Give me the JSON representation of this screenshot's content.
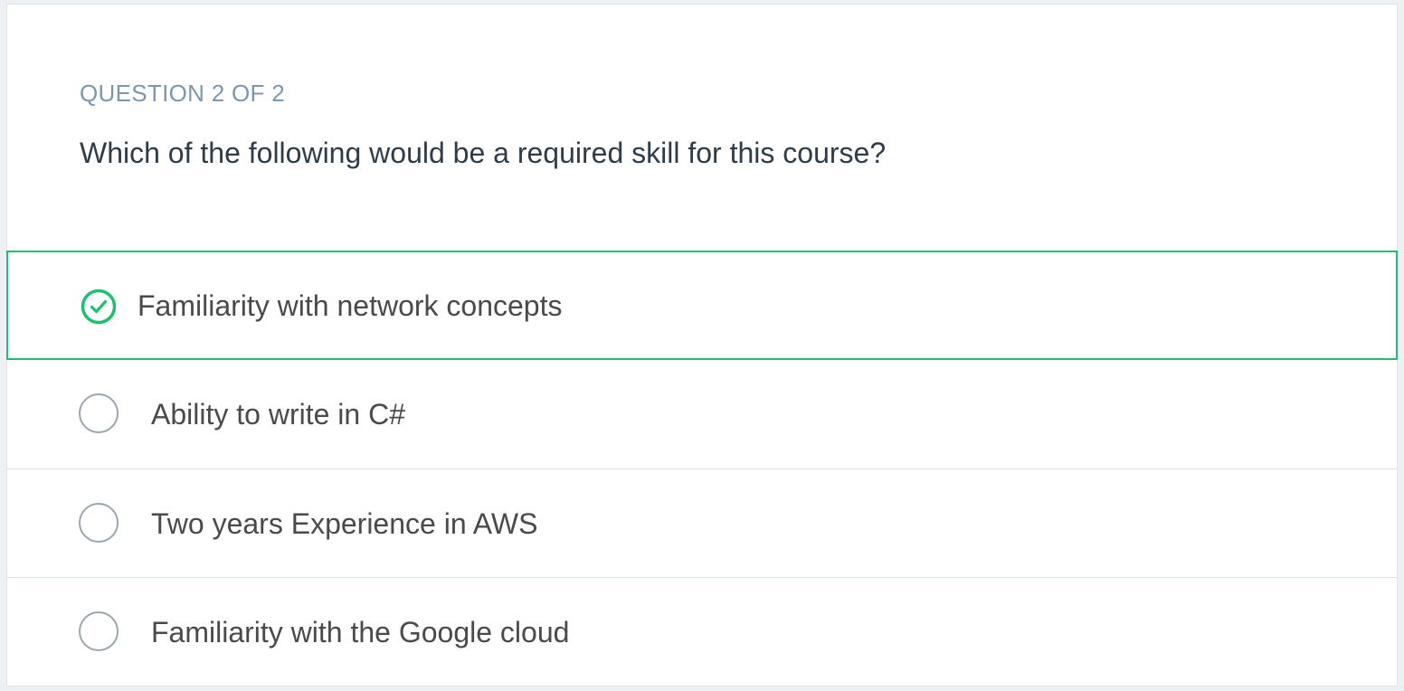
{
  "quiz": {
    "counter": "QUESTION 2 OF 2",
    "question": "Which of the following would be a required skill for this course?",
    "accent_color": "#1fbf71",
    "options": [
      {
        "label": "Familiarity with network concepts",
        "selected": true,
        "icon": "check-circle-icon"
      },
      {
        "label": "Ability to write in C#",
        "selected": false,
        "icon": "radio-circle-icon"
      },
      {
        "label": "Two years Experience in AWS",
        "selected": false,
        "icon": "radio-circle-icon"
      },
      {
        "label": "Familiarity with the Google cloud",
        "selected": false,
        "icon": "radio-circle-icon"
      }
    ]
  }
}
